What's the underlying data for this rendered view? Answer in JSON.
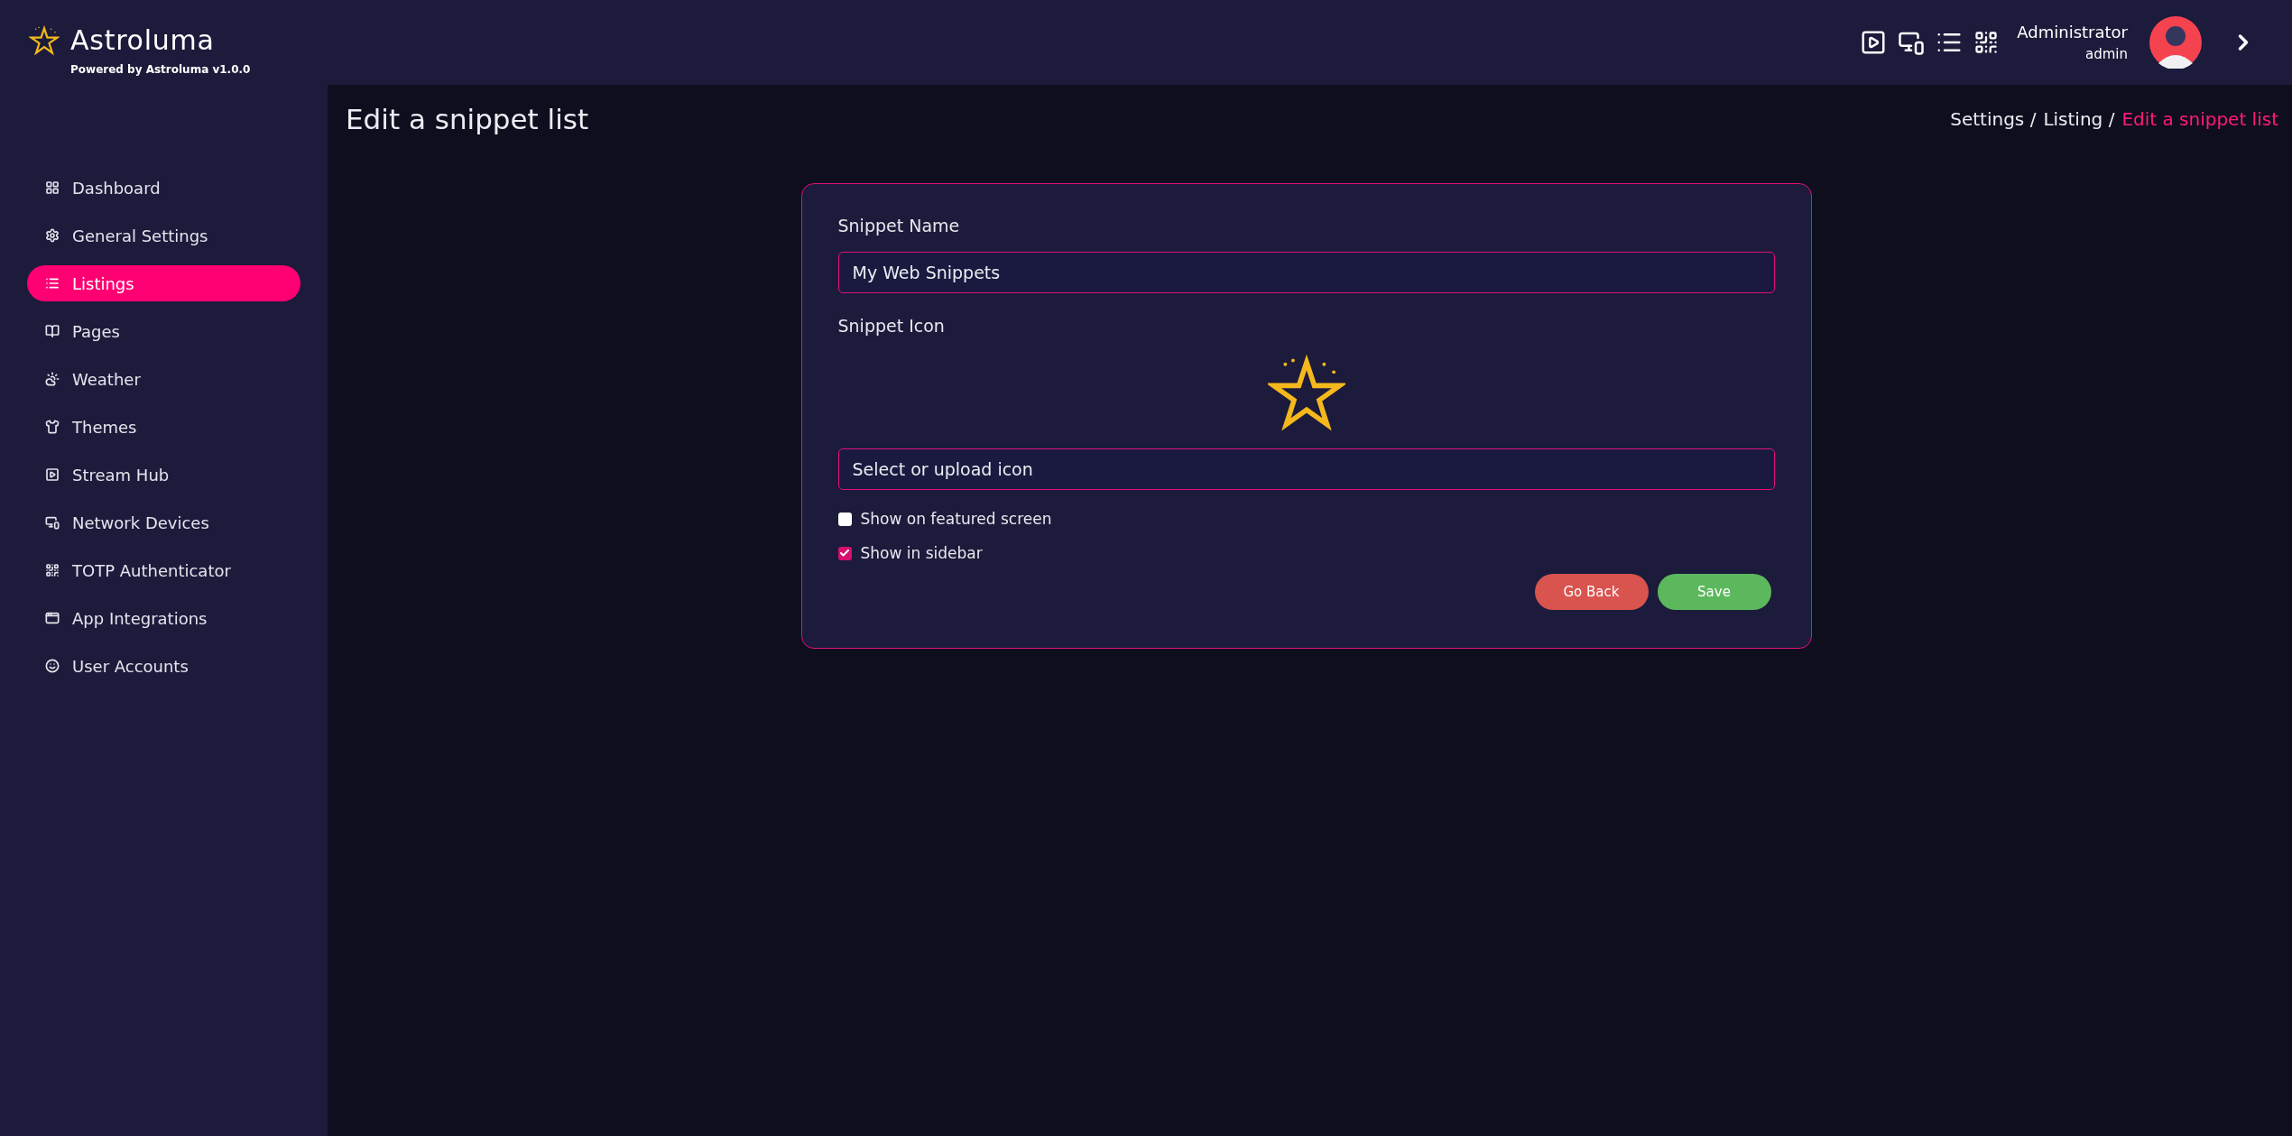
{
  "brand": {
    "name": "Astroluma",
    "tagline": "Powered by Astroluma v1.0.0"
  },
  "header": {
    "user": {
      "name": "Administrator",
      "role": "admin"
    }
  },
  "sidebar": {
    "items": [
      {
        "label": "Dashboard",
        "selected": false
      },
      {
        "label": "General Settings",
        "selected": false
      },
      {
        "label": "Listings",
        "selected": true
      },
      {
        "label": "Pages",
        "selected": false
      },
      {
        "label": "Weather",
        "selected": false
      },
      {
        "label": "Themes",
        "selected": false
      },
      {
        "label": "Stream Hub",
        "selected": false
      },
      {
        "label": "Network Devices",
        "selected": false
      },
      {
        "label": "TOTP Authenticator",
        "selected": false
      },
      {
        "label": "App Integrations",
        "selected": false
      },
      {
        "label": "User Accounts",
        "selected": false
      }
    ]
  },
  "page": {
    "title": "Edit a snippet list",
    "breadcrumb": [
      {
        "label": "Settings /",
        "current": false
      },
      {
        "label": "Listing /",
        "current": false
      },
      {
        "label": "Edit a snippet list",
        "current": true
      }
    ]
  },
  "form": {
    "name_label": "Snippet Name",
    "name_value": "My Web Snippets",
    "icon_label": "Snippet Icon",
    "icon_picker": "Select or upload icon",
    "checkboxes": [
      {
        "label": "Show on featured screen",
        "checked": false
      },
      {
        "label": "Show in sidebar",
        "checked": true
      }
    ],
    "buttons": [
      {
        "label": "Go Back",
        "kind": "cancel"
      },
      {
        "label": "Save",
        "kind": "save"
      }
    ]
  }
}
